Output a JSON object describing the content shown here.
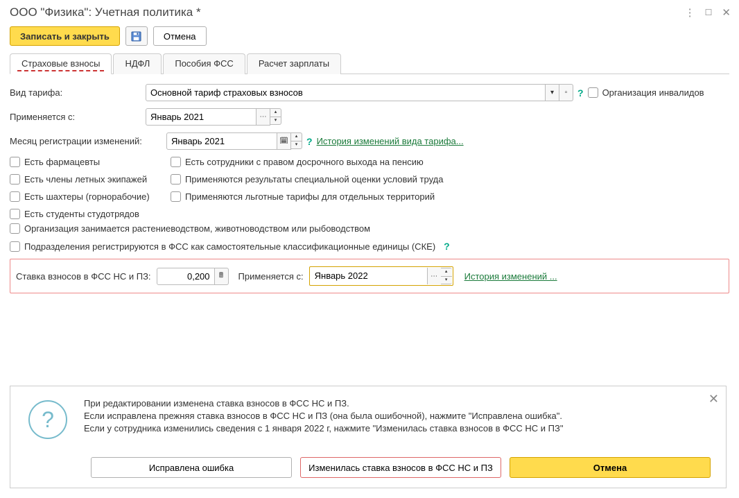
{
  "titlebar": {
    "title": "ООО \"Физика\": Учетная политика *"
  },
  "toolbar": {
    "save_close": "Записать и закрыть",
    "cancel": "Отмена"
  },
  "tabs": {
    "t1": "Страховые взносы",
    "t2": "НДФЛ",
    "t3": "Пособия ФСС",
    "t4": "Расчет зарплаты"
  },
  "form": {
    "tariff_label": "Вид тарифа:",
    "tariff_value": "Основной тариф страховых взносов",
    "org_disabled": "Организация инвалидов",
    "applies_from_label": "Применяется с:",
    "applies_from_value": "Январь 2021",
    "reg_month_label": "Месяц регистрации изменений:",
    "reg_month_value": "Январь 2021",
    "history_tariff_link": "История изменений вида тарифа...",
    "checks": {
      "c1": "Есть фармацевты",
      "c2": "Есть члены летных экипажей",
      "c3": "Есть шахтеры (горнорабочие)",
      "c4": "Есть студенты студотрядов",
      "c5": "Есть сотрудники с правом досрочного выхода на пенсию",
      "c6": "Применяются результаты специальной оценки условий труда",
      "c7": "Применяются льготные тарифы для отдельных территорий",
      "c8": "Организация занимается растениеводством, животноводством или рыбоводством",
      "c9": "Подразделения регистрируются в ФСС как самостоятельные классификационные единицы (СКЕ)"
    },
    "rate_label": "Ставка взносов в ФСС НС и ПЗ:",
    "rate_value": "0,200",
    "rate_from_label": "Применяется с:",
    "rate_from_value": "Январь 2022",
    "history_link": "История изменений ..."
  },
  "dialog": {
    "line1": "При редактировании изменена ставка взносов в ФСС НС и ПЗ.",
    "line2": "Если исправлена прежняя ставка взносов в ФСС НС и ПЗ (она была ошибочной), нажмите \"Исправлена ошибка\".",
    "line3": "Если у сотрудника изменились сведения с 1 января 2022 г, нажмите \"Изменилась ставка взносов в ФСС НС и ПЗ\"",
    "btn1": "Исправлена ошибка",
    "btn2": "Изменилась ставка взносов в ФСС НС и ПЗ",
    "btn3": "Отмена"
  }
}
